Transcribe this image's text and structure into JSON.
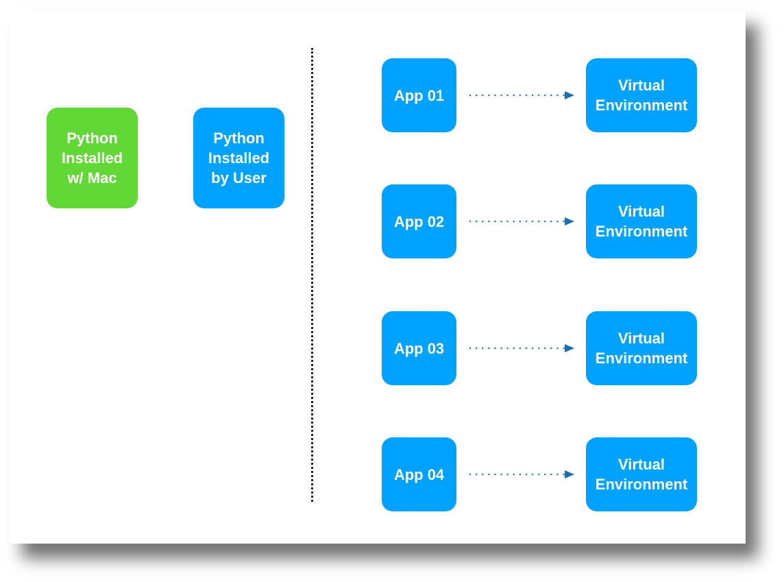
{
  "colors": {
    "blue": "#00a2ff",
    "green": "#61d836",
    "arrow": "#1f6fb0"
  },
  "left": {
    "mac": "Python\nInstalled\nw/ Mac",
    "user": "Python\nInstalled\nby User"
  },
  "rows": [
    {
      "app": "App 01",
      "env": "Virtual\nEnvironment"
    },
    {
      "app": "App 02",
      "env": "Virtual\nEnvironment"
    },
    {
      "app": "App 03",
      "env": "Virtual\nEnvironment"
    },
    {
      "app": "App 04",
      "env": "Virtual\nEnvironment"
    }
  ]
}
